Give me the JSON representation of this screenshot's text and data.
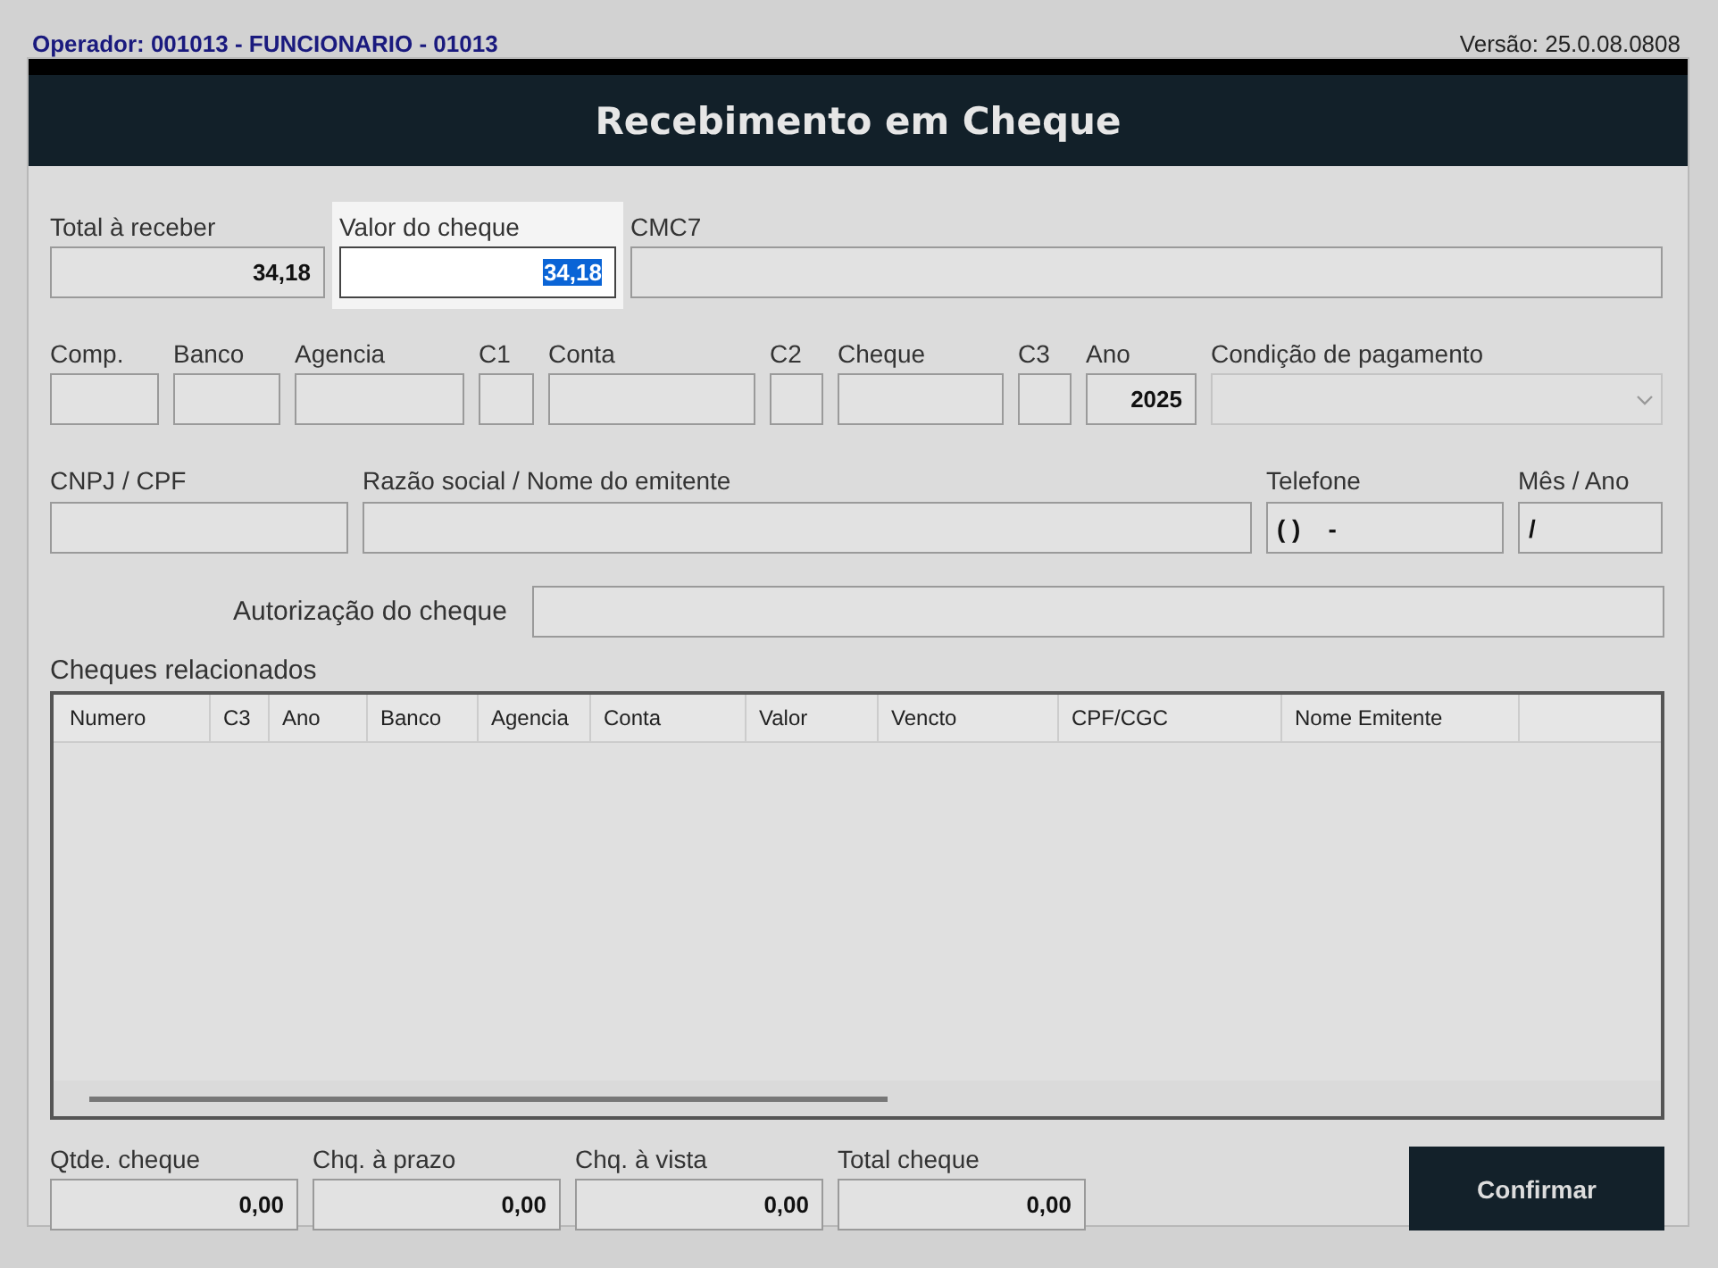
{
  "header": {
    "operator": "Operador: 001013 - FUNCIONARIO - 01013",
    "version": "Versão: 25.0.08.0808"
  },
  "dialog": {
    "title": "Recebimento em Cheque",
    "field_rows": [
      [
        {
          "label": "Total à receber",
          "kind": "number",
          "value": "34,18",
          "focused": false
        },
        {
          "label": "Valor do cheque",
          "kind": "number",
          "value": "34,18",
          "focused": true
        },
        {
          "label": "CMC7",
          "kind": "text",
          "focused": false
        }
      ],
      [
        {
          "label": "Comp.",
          "kind": "text",
          "focused": false
        },
        {
          "label": "Banco",
          "kind": "text",
          "focused": false
        },
        {
          "label": "Agencia",
          "kind": "text",
          "focused": false
        },
        {
          "label": "C1",
          "kind": "text",
          "focused": false
        },
        {
          "label": "Conta",
          "kind": "text",
          "focused": false
        },
        {
          "label": "C2",
          "kind": "text",
          "focused": false
        },
        {
          "label": "Cheque",
          "kind": "text",
          "focused": false
        },
        {
          "label": "C3",
          "kind": "text",
          "focused": false
        },
        {
          "label": "Ano",
          "kind": "number",
          "value": "2025",
          "focused": false
        },
        {
          "label": "Condição de pagamento",
          "kind": "dropdown",
          "focused": false
        }
      ],
      [
        {
          "label": "CNPJ / CPF",
          "kind": "text",
          "focused": false
        },
        {
          "label": "Razão social / Nome do emitente",
          "kind": "text",
          "focused": false
        },
        {
          "label": "Telefone",
          "kind": "masked",
          "value": "( )    -",
          "focused": false
        },
        {
          "label": "Mês / Ano",
          "kind": "masked",
          "value": "/",
          "focused": false
        }
      ]
    ],
    "authorization": {
      "label": "Autorização do cheque"
    },
    "table": {
      "title": "Cheques relacionados",
      "columns": [
        "Numero",
        "C3",
        "Ano",
        "Banco",
        "Agencia",
        "Conta",
        "Valor",
        "Vencto",
        "CPF/CGC",
        "Nome Emitente"
      ]
    },
    "totals": [
      {
        "label": "Qtde. cheque",
        "value": "0,00"
      },
      {
        "label": "Chq. à prazo",
        "value": "0,00"
      },
      {
        "label": "Chq. à vista",
        "value": "0,00"
      },
      {
        "label": "Total cheque",
        "value": "0,00"
      }
    ],
    "confirm_button": "Confirmar"
  }
}
